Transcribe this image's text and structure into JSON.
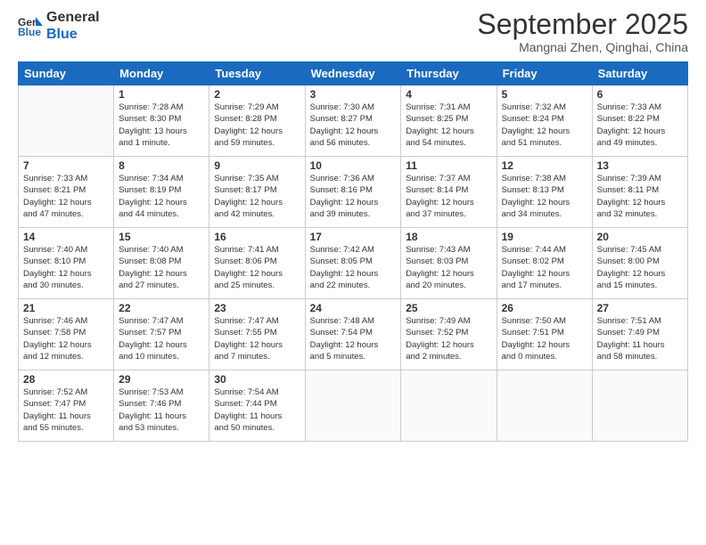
{
  "logo": {
    "general": "General",
    "blue": "Blue"
  },
  "header": {
    "month": "September 2025",
    "location": "Mangnai Zhen, Qinghai, China"
  },
  "days": [
    "Sunday",
    "Monday",
    "Tuesday",
    "Wednesday",
    "Thursday",
    "Friday",
    "Saturday"
  ],
  "weeks": [
    [
      {
        "day": null,
        "content": null
      },
      {
        "day": "1",
        "content": "Sunrise: 7:28 AM\nSunset: 8:30 PM\nDaylight: 13 hours\nand 1 minute."
      },
      {
        "day": "2",
        "content": "Sunrise: 7:29 AM\nSunset: 8:28 PM\nDaylight: 12 hours\nand 59 minutes."
      },
      {
        "day": "3",
        "content": "Sunrise: 7:30 AM\nSunset: 8:27 PM\nDaylight: 12 hours\nand 56 minutes."
      },
      {
        "day": "4",
        "content": "Sunrise: 7:31 AM\nSunset: 8:25 PM\nDaylight: 12 hours\nand 54 minutes."
      },
      {
        "day": "5",
        "content": "Sunrise: 7:32 AM\nSunset: 8:24 PM\nDaylight: 12 hours\nand 51 minutes."
      },
      {
        "day": "6",
        "content": "Sunrise: 7:33 AM\nSunset: 8:22 PM\nDaylight: 12 hours\nand 49 minutes."
      }
    ],
    [
      {
        "day": "7",
        "content": "Sunrise: 7:33 AM\nSunset: 8:21 PM\nDaylight: 12 hours\nand 47 minutes."
      },
      {
        "day": "8",
        "content": "Sunrise: 7:34 AM\nSunset: 8:19 PM\nDaylight: 12 hours\nand 44 minutes."
      },
      {
        "day": "9",
        "content": "Sunrise: 7:35 AM\nSunset: 8:17 PM\nDaylight: 12 hours\nand 42 minutes."
      },
      {
        "day": "10",
        "content": "Sunrise: 7:36 AM\nSunset: 8:16 PM\nDaylight: 12 hours\nand 39 minutes."
      },
      {
        "day": "11",
        "content": "Sunrise: 7:37 AM\nSunset: 8:14 PM\nDaylight: 12 hours\nand 37 minutes."
      },
      {
        "day": "12",
        "content": "Sunrise: 7:38 AM\nSunset: 8:13 PM\nDaylight: 12 hours\nand 34 minutes."
      },
      {
        "day": "13",
        "content": "Sunrise: 7:39 AM\nSunset: 8:11 PM\nDaylight: 12 hours\nand 32 minutes."
      }
    ],
    [
      {
        "day": "14",
        "content": "Sunrise: 7:40 AM\nSunset: 8:10 PM\nDaylight: 12 hours\nand 30 minutes."
      },
      {
        "day": "15",
        "content": "Sunrise: 7:40 AM\nSunset: 8:08 PM\nDaylight: 12 hours\nand 27 minutes."
      },
      {
        "day": "16",
        "content": "Sunrise: 7:41 AM\nSunset: 8:06 PM\nDaylight: 12 hours\nand 25 minutes."
      },
      {
        "day": "17",
        "content": "Sunrise: 7:42 AM\nSunset: 8:05 PM\nDaylight: 12 hours\nand 22 minutes."
      },
      {
        "day": "18",
        "content": "Sunrise: 7:43 AM\nSunset: 8:03 PM\nDaylight: 12 hours\nand 20 minutes."
      },
      {
        "day": "19",
        "content": "Sunrise: 7:44 AM\nSunset: 8:02 PM\nDaylight: 12 hours\nand 17 minutes."
      },
      {
        "day": "20",
        "content": "Sunrise: 7:45 AM\nSunset: 8:00 PM\nDaylight: 12 hours\nand 15 minutes."
      }
    ],
    [
      {
        "day": "21",
        "content": "Sunrise: 7:46 AM\nSunset: 7:58 PM\nDaylight: 12 hours\nand 12 minutes."
      },
      {
        "day": "22",
        "content": "Sunrise: 7:47 AM\nSunset: 7:57 PM\nDaylight: 12 hours\nand 10 minutes."
      },
      {
        "day": "23",
        "content": "Sunrise: 7:47 AM\nSunset: 7:55 PM\nDaylight: 12 hours\nand 7 minutes."
      },
      {
        "day": "24",
        "content": "Sunrise: 7:48 AM\nSunset: 7:54 PM\nDaylight: 12 hours\nand 5 minutes."
      },
      {
        "day": "25",
        "content": "Sunrise: 7:49 AM\nSunset: 7:52 PM\nDaylight: 12 hours\nand 2 minutes."
      },
      {
        "day": "26",
        "content": "Sunrise: 7:50 AM\nSunset: 7:51 PM\nDaylight: 12 hours\nand 0 minutes."
      },
      {
        "day": "27",
        "content": "Sunrise: 7:51 AM\nSunset: 7:49 PM\nDaylight: 11 hours\nand 58 minutes."
      }
    ],
    [
      {
        "day": "28",
        "content": "Sunrise: 7:52 AM\nSunset: 7:47 PM\nDaylight: 11 hours\nand 55 minutes."
      },
      {
        "day": "29",
        "content": "Sunrise: 7:53 AM\nSunset: 7:46 PM\nDaylight: 11 hours\nand 53 minutes."
      },
      {
        "day": "30",
        "content": "Sunrise: 7:54 AM\nSunset: 7:44 PM\nDaylight: 11 hours\nand 50 minutes."
      },
      {
        "day": null,
        "content": null
      },
      {
        "day": null,
        "content": null
      },
      {
        "day": null,
        "content": null
      },
      {
        "day": null,
        "content": null
      }
    ]
  ]
}
